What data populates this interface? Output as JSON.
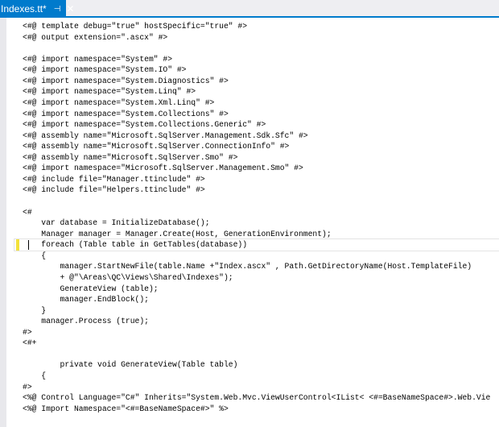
{
  "tab": {
    "title": "Indexes.tt*",
    "pin_icon": "pin-icon",
    "close_icon": "close-icon",
    "accent": "#007acc"
  },
  "editor": {
    "current_line": 20,
    "changed_line_color": "#f3e23a",
    "lines": [
      "<#@ template debug=\"true\" hostSpecific=\"true\" #>",
      "<#@ output extension=\".ascx\" #>",
      "",
      "<#@ import namespace=\"System\" #>",
      "<#@ import namespace=\"System.IO\" #>",
      "<#@ import namespace=\"System.Diagnostics\" #>",
      "<#@ import namespace=\"System.Linq\" #>",
      "<#@ import namespace=\"System.Xml.Linq\" #>",
      "<#@ import namespace=\"System.Collections\" #>",
      "<#@ import namespace=\"System.Collections.Generic\" #>",
      "<#@ assembly name=\"Microsoft.SqlServer.Management.Sdk.Sfc\" #>",
      "<#@ assembly name=\"Microsoft.SqlServer.ConnectionInfo\" #>",
      "<#@ assembly name=\"Microsoft.SqlServer.Smo\" #>",
      "<#@ import namespace=\"Microsoft.SqlServer.Management.Smo\" #>",
      "<#@ include file=\"Manager.ttinclude\" #>",
      "<#@ include file=\"Helpers.ttinclude\" #>",
      "",
      "<#",
      "    var database = InitializeDatabase();",
      "    Manager manager = Manager.Create(Host, GenerationEnvironment);",
      "    foreach (Table table in GetTables(database))",
      "    {",
      "        manager.StartNewFile(table.Name +\"Index.ascx\" , Path.GetDirectoryName(Host.TemplateFile)",
      "        + @\"\\Areas\\QC\\Views\\Shared\\Indexes\");",
      "        GenerateView (table);",
      "        manager.EndBlock();",
      "    }",
      "    manager.Process (true);",
      "#>",
      "<#+",
      "",
      "        private void GenerateView(Table table)",
      "    {",
      "#>",
      "<%@ Control Language=\"C#\" Inherits=\"System.Web.Mvc.ViewUserControl<IList< <#=BaseNameSpace#>.Web.Vie",
      "<%@ Import Namespace=\"<#=BaseNameSpace#>\" %>",
      ""
    ]
  }
}
